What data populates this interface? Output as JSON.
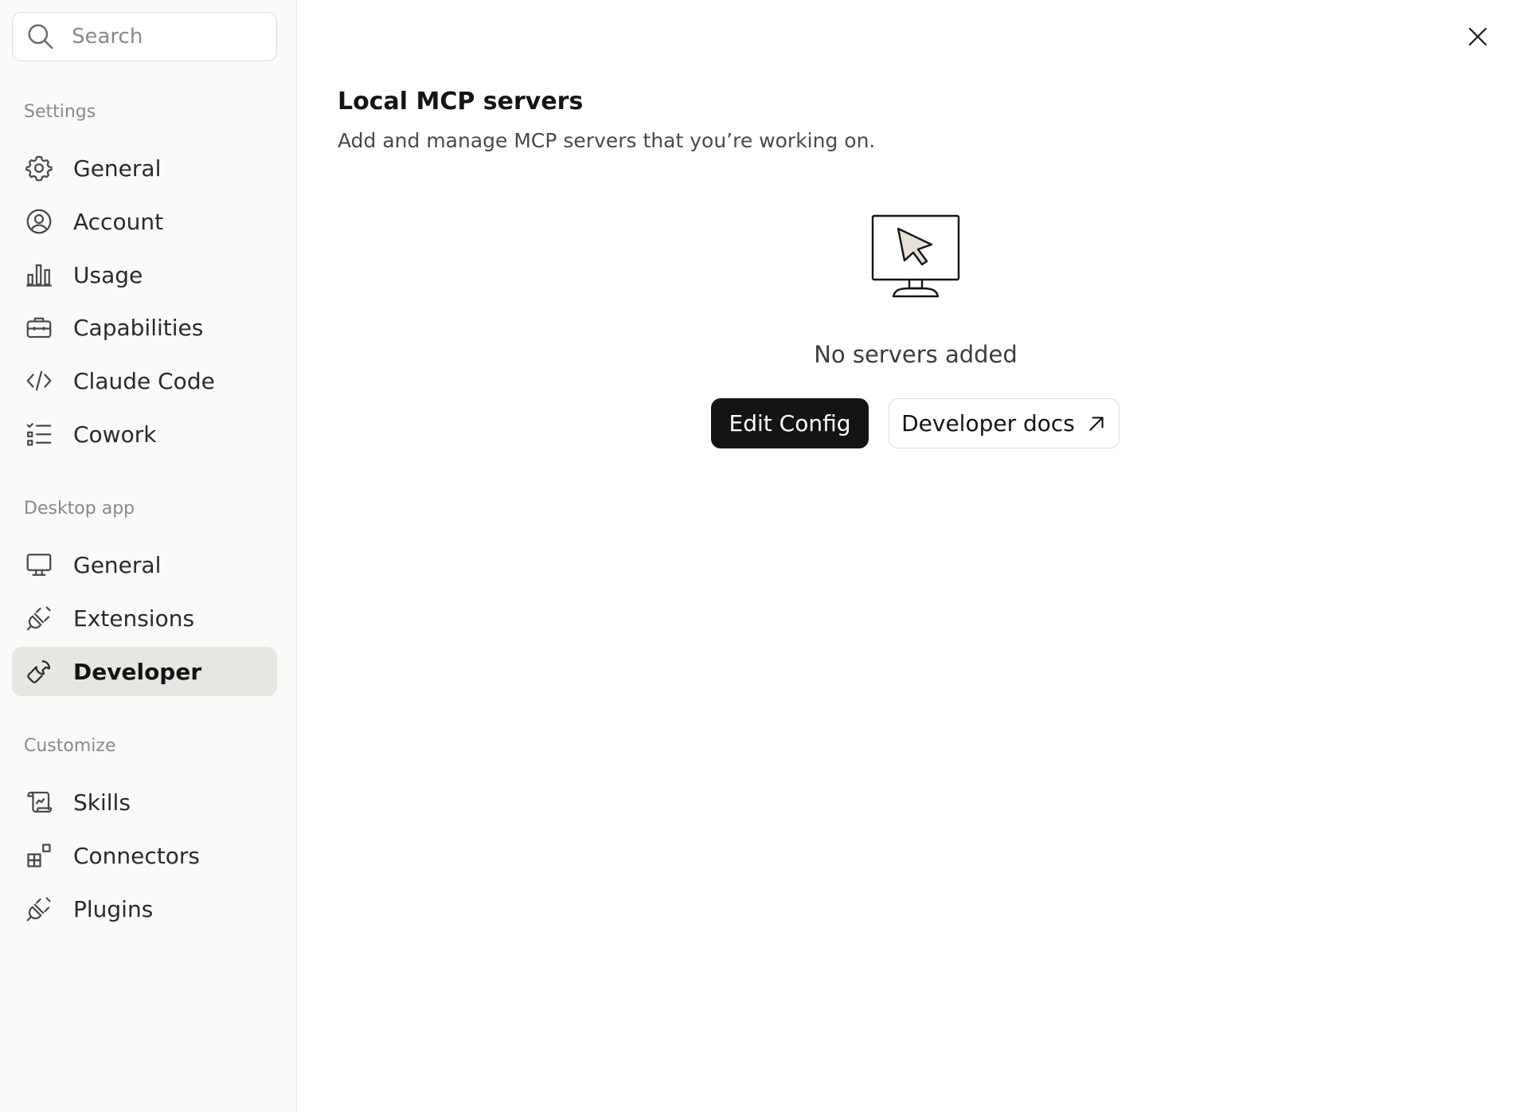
{
  "search": {
    "placeholder": "Search"
  },
  "sections": {
    "settings": "Settings",
    "desktop_app": "Desktop app",
    "customize": "Customize"
  },
  "nav": {
    "settings_items": [
      {
        "label": "General",
        "icon": "gear-icon"
      },
      {
        "label": "Account",
        "icon": "user-circle-icon"
      },
      {
        "label": "Usage",
        "icon": "bar-chart-icon"
      },
      {
        "label": "Capabilities",
        "icon": "briefcase-icon"
      },
      {
        "label": "Claude Code",
        "icon": "code-icon"
      },
      {
        "label": "Cowork",
        "icon": "checklist-icon"
      }
    ],
    "desktop_items": [
      {
        "label": "General",
        "icon": "monitor-icon"
      },
      {
        "label": "Extensions",
        "icon": "plug-icon"
      },
      {
        "label": "Developer",
        "icon": "wrench-icon",
        "active": true
      }
    ],
    "customize_items": [
      {
        "label": "Skills",
        "icon": "scroll-icon"
      },
      {
        "label": "Connectors",
        "icon": "blocks-icon"
      },
      {
        "label": "Plugins",
        "icon": "plug-icon"
      }
    ]
  },
  "main": {
    "title": "Local MCP servers",
    "subtitle": "Add and manage MCP servers that you’re working on.",
    "empty_state": "No servers added",
    "edit_config_label": "Edit Config",
    "developer_docs_label": "Developer docs"
  },
  "colors": {
    "primary_button": "#141413",
    "active_nav_bg": "#e6e6e3",
    "sidebar_bg": "#fafaf9"
  }
}
